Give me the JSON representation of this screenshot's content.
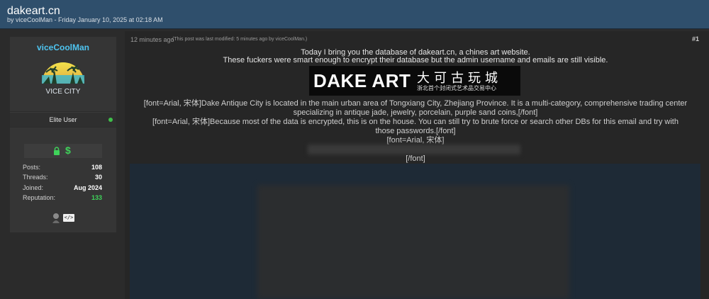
{
  "thread": {
    "title": "dakeart.cn",
    "byline": "by viceCoolMan - Friday January 10, 2025 at 02:18 AM"
  },
  "user": {
    "name": "viceCoolMan",
    "avatar_text": "VICE CITY",
    "title": "Elite User",
    "stats": [
      {
        "label": "Posts:",
        "value": "108"
      },
      {
        "label": "Threads:",
        "value": "30"
      },
      {
        "label": "Joined:",
        "value": "Aug 2024"
      },
      {
        "label": "Reputation:",
        "value": "133"
      }
    ],
    "status_color": "#3fbf4a",
    "reputation_color": "#3fd35a",
    "award_code_label": "</>"
  },
  "post": {
    "time": "12 minutes ago",
    "edited_note": "(This post was last modified: 5 minutes ago by viceCoolMan.)",
    "number": "#1",
    "lines": [
      "Today I bring you the database of dakeart.cn, a chines art website.",
      "These fuckers were smart enough to encrypt their database but the admin username and emails are still visible.",
      "[font=Arial, 宋体]Dake Antique City is located in the main urban area of Tongxiang City, Zhejiang Province. It is a multi-category, comprehensive trading center",
      "specializing in antique jade, jewelry, porcelain, purple sand coins,[/font]",
      "[font=Arial, 宋体]Because most of the data is encrypted, this is on the house. You can still try to brute force or search other DBs for this email and try with",
      "those passwords.[/font]",
      "[font=Arial, 宋体]",
      "[/font]"
    ],
    "logo": {
      "main": "DAKE ART",
      "cn": "大可古玩城",
      "cn_sub": "浙北首个封闭式艺术品交易中心"
    }
  }
}
